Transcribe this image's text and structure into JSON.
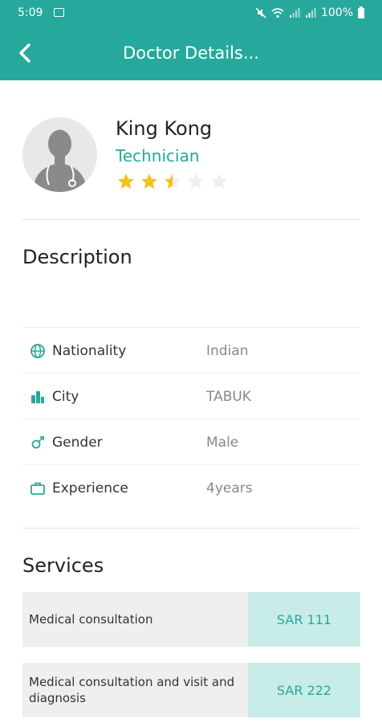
{
  "status_bar": {
    "time": "5:09",
    "battery_percent": "100%",
    "icons": [
      "gallery-icon",
      "mute-icon",
      "wifi-icon",
      "signal-icon",
      "signal-icon",
      "battery-icon"
    ]
  },
  "app_bar": {
    "title": "Doctor Details...",
    "back_icon": "chevron-left-icon",
    "background": "#26a99c"
  },
  "profile": {
    "name": "King Kong",
    "role": "Technician",
    "rating": 2.5,
    "rating_max": 5,
    "avatar_icon": "doctor-avatar-icon"
  },
  "description": {
    "title": "Description",
    "text": ""
  },
  "info": [
    {
      "icon": "globe-icon",
      "label": "Nationality",
      "value": "Indian"
    },
    {
      "icon": "city-icon",
      "label": "City",
      "value": "TABUK"
    },
    {
      "icon": "gender-icon",
      "label": "Gender",
      "value": "Male"
    },
    {
      "icon": "briefcase-icon",
      "label": "Experience",
      "value": "4years"
    }
  ],
  "services": {
    "title": "Services",
    "items": [
      {
        "name": "Medical consultation",
        "price": "SAR 111"
      },
      {
        "name": "Medical consultation and visit and diagnosis",
        "price": "SAR 222"
      }
    ]
  },
  "colors": {
    "accent": "#26a99c",
    "price_bg": "#c8ece8",
    "star_filled": "#f4c21c",
    "star_empty": "#eeeeee"
  }
}
